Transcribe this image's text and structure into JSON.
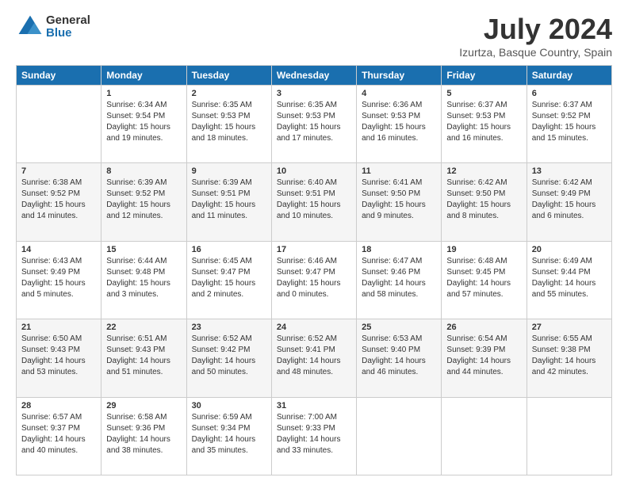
{
  "logo": {
    "general": "General",
    "blue": "Blue"
  },
  "title": "July 2024",
  "subtitle": "Izurtza, Basque Country, Spain",
  "weekdays": [
    "Sunday",
    "Monday",
    "Tuesday",
    "Wednesday",
    "Thursday",
    "Friday",
    "Saturday"
  ],
  "weeks": [
    [
      {
        "day": "",
        "info": ""
      },
      {
        "day": "1",
        "info": "Sunrise: 6:34 AM\nSunset: 9:54 PM\nDaylight: 15 hours\nand 19 minutes."
      },
      {
        "day": "2",
        "info": "Sunrise: 6:35 AM\nSunset: 9:53 PM\nDaylight: 15 hours\nand 18 minutes."
      },
      {
        "day": "3",
        "info": "Sunrise: 6:35 AM\nSunset: 9:53 PM\nDaylight: 15 hours\nand 17 minutes."
      },
      {
        "day": "4",
        "info": "Sunrise: 6:36 AM\nSunset: 9:53 PM\nDaylight: 15 hours\nand 16 minutes."
      },
      {
        "day": "5",
        "info": "Sunrise: 6:37 AM\nSunset: 9:53 PM\nDaylight: 15 hours\nand 16 minutes."
      },
      {
        "day": "6",
        "info": "Sunrise: 6:37 AM\nSunset: 9:52 PM\nDaylight: 15 hours\nand 15 minutes."
      }
    ],
    [
      {
        "day": "7",
        "info": "Sunrise: 6:38 AM\nSunset: 9:52 PM\nDaylight: 15 hours\nand 14 minutes."
      },
      {
        "day": "8",
        "info": "Sunrise: 6:39 AM\nSunset: 9:52 PM\nDaylight: 15 hours\nand 12 minutes."
      },
      {
        "day": "9",
        "info": "Sunrise: 6:39 AM\nSunset: 9:51 PM\nDaylight: 15 hours\nand 11 minutes."
      },
      {
        "day": "10",
        "info": "Sunrise: 6:40 AM\nSunset: 9:51 PM\nDaylight: 15 hours\nand 10 minutes."
      },
      {
        "day": "11",
        "info": "Sunrise: 6:41 AM\nSunset: 9:50 PM\nDaylight: 15 hours\nand 9 minutes."
      },
      {
        "day": "12",
        "info": "Sunrise: 6:42 AM\nSunset: 9:50 PM\nDaylight: 15 hours\nand 8 minutes."
      },
      {
        "day": "13",
        "info": "Sunrise: 6:42 AM\nSunset: 9:49 PM\nDaylight: 15 hours\nand 6 minutes."
      }
    ],
    [
      {
        "day": "14",
        "info": "Sunrise: 6:43 AM\nSunset: 9:49 PM\nDaylight: 15 hours\nand 5 minutes."
      },
      {
        "day": "15",
        "info": "Sunrise: 6:44 AM\nSunset: 9:48 PM\nDaylight: 15 hours\nand 3 minutes."
      },
      {
        "day": "16",
        "info": "Sunrise: 6:45 AM\nSunset: 9:47 PM\nDaylight: 15 hours\nand 2 minutes."
      },
      {
        "day": "17",
        "info": "Sunrise: 6:46 AM\nSunset: 9:47 PM\nDaylight: 15 hours\nand 0 minutes."
      },
      {
        "day": "18",
        "info": "Sunrise: 6:47 AM\nSunset: 9:46 PM\nDaylight: 14 hours\nand 58 minutes."
      },
      {
        "day": "19",
        "info": "Sunrise: 6:48 AM\nSunset: 9:45 PM\nDaylight: 14 hours\nand 57 minutes."
      },
      {
        "day": "20",
        "info": "Sunrise: 6:49 AM\nSunset: 9:44 PM\nDaylight: 14 hours\nand 55 minutes."
      }
    ],
    [
      {
        "day": "21",
        "info": "Sunrise: 6:50 AM\nSunset: 9:43 PM\nDaylight: 14 hours\nand 53 minutes."
      },
      {
        "day": "22",
        "info": "Sunrise: 6:51 AM\nSunset: 9:43 PM\nDaylight: 14 hours\nand 51 minutes."
      },
      {
        "day": "23",
        "info": "Sunrise: 6:52 AM\nSunset: 9:42 PM\nDaylight: 14 hours\nand 50 minutes."
      },
      {
        "day": "24",
        "info": "Sunrise: 6:52 AM\nSunset: 9:41 PM\nDaylight: 14 hours\nand 48 minutes."
      },
      {
        "day": "25",
        "info": "Sunrise: 6:53 AM\nSunset: 9:40 PM\nDaylight: 14 hours\nand 46 minutes."
      },
      {
        "day": "26",
        "info": "Sunrise: 6:54 AM\nSunset: 9:39 PM\nDaylight: 14 hours\nand 44 minutes."
      },
      {
        "day": "27",
        "info": "Sunrise: 6:55 AM\nSunset: 9:38 PM\nDaylight: 14 hours\nand 42 minutes."
      }
    ],
    [
      {
        "day": "28",
        "info": "Sunrise: 6:57 AM\nSunset: 9:37 PM\nDaylight: 14 hours\nand 40 minutes."
      },
      {
        "day": "29",
        "info": "Sunrise: 6:58 AM\nSunset: 9:36 PM\nDaylight: 14 hours\nand 38 minutes."
      },
      {
        "day": "30",
        "info": "Sunrise: 6:59 AM\nSunset: 9:34 PM\nDaylight: 14 hours\nand 35 minutes."
      },
      {
        "day": "31",
        "info": "Sunrise: 7:00 AM\nSunset: 9:33 PM\nDaylight: 14 hours\nand 33 minutes."
      },
      {
        "day": "",
        "info": ""
      },
      {
        "day": "",
        "info": ""
      },
      {
        "day": "",
        "info": ""
      }
    ]
  ]
}
